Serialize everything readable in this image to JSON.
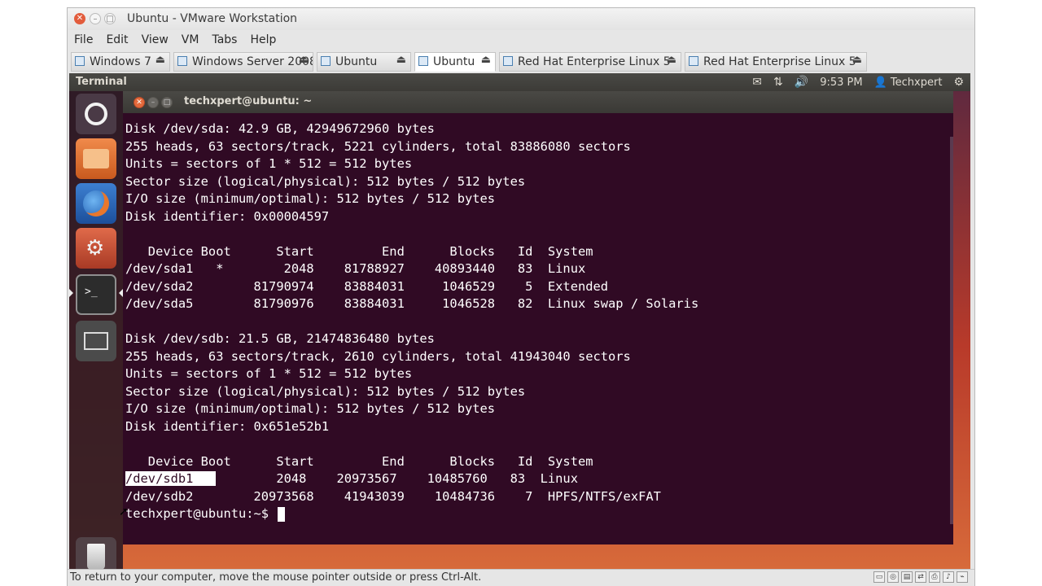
{
  "vmware": {
    "title": "Ubuntu - VMware Workstation",
    "menu": [
      "File",
      "Edit",
      "View",
      "VM",
      "Tabs",
      "Help"
    ],
    "tabs": [
      {
        "label": "Windows 7",
        "active": false
      },
      {
        "label": "Windows Server 2008",
        "active": false
      },
      {
        "label": "Ubuntu",
        "active": false
      },
      {
        "label": "Ubuntu",
        "active": true
      },
      {
        "label": "Red Hat Enterprise Linux 5",
        "active": false
      },
      {
        "label": "Red Hat Enterprise Linux 5",
        "active": false
      }
    ],
    "status_text": "To return to your computer, move the mouse pointer outside or press Ctrl-Alt."
  },
  "ubuntu": {
    "panel_title": "Terminal",
    "time": "9:53 PM",
    "user": "Techxpert",
    "launcher": [
      "dash-home",
      "files",
      "firefox",
      "system-settings",
      "terminal",
      "workspace-switcher",
      "trash"
    ]
  },
  "terminal": {
    "title": "techxpert@ubuntu: ~",
    "lines": [
      "Disk /dev/sda: 42.9 GB, 42949672960 bytes",
      "255 heads, 63 sectors/track, 5221 cylinders, total 83886080 sectors",
      "Units = sectors of 1 * 512 = 512 bytes",
      "Sector size (logical/physical): 512 bytes / 512 bytes",
      "I/O size (minimum/optimal): 512 bytes / 512 bytes",
      "Disk identifier: 0x00004597",
      "",
      "   Device Boot      Start         End      Blocks   Id  System",
      "/dev/sda1   *        2048    81788927    40893440   83  Linux",
      "/dev/sda2        81790974    83884031     1046529    5  Extended",
      "/dev/sda5        81790976    83884031     1046528   82  Linux swap / Solaris",
      "",
      "Disk /dev/sdb: 21.5 GB, 21474836480 bytes",
      "255 heads, 63 sectors/track, 2610 cylinders, total 41943040 sectors",
      "Units = sectors of 1 * 512 = 512 bytes",
      "Sector size (logical/physical): 512 bytes / 512 bytes",
      "I/O size (minimum/optimal): 512 bytes / 512 bytes",
      "Disk identifier: 0x651e52b1",
      "",
      "   Device Boot      Start         End      Blocks   Id  System"
    ],
    "selected_part": "/dev/sdb1   ",
    "sdb1_rest": "        2048    20973567    10485760   83  Linux",
    "sdb2_line": "/dev/sdb2        20973568    41943039    10484736    7  HPFS/NTFS/exFAT",
    "prompt": "techxpert@ubuntu:~$ "
  }
}
